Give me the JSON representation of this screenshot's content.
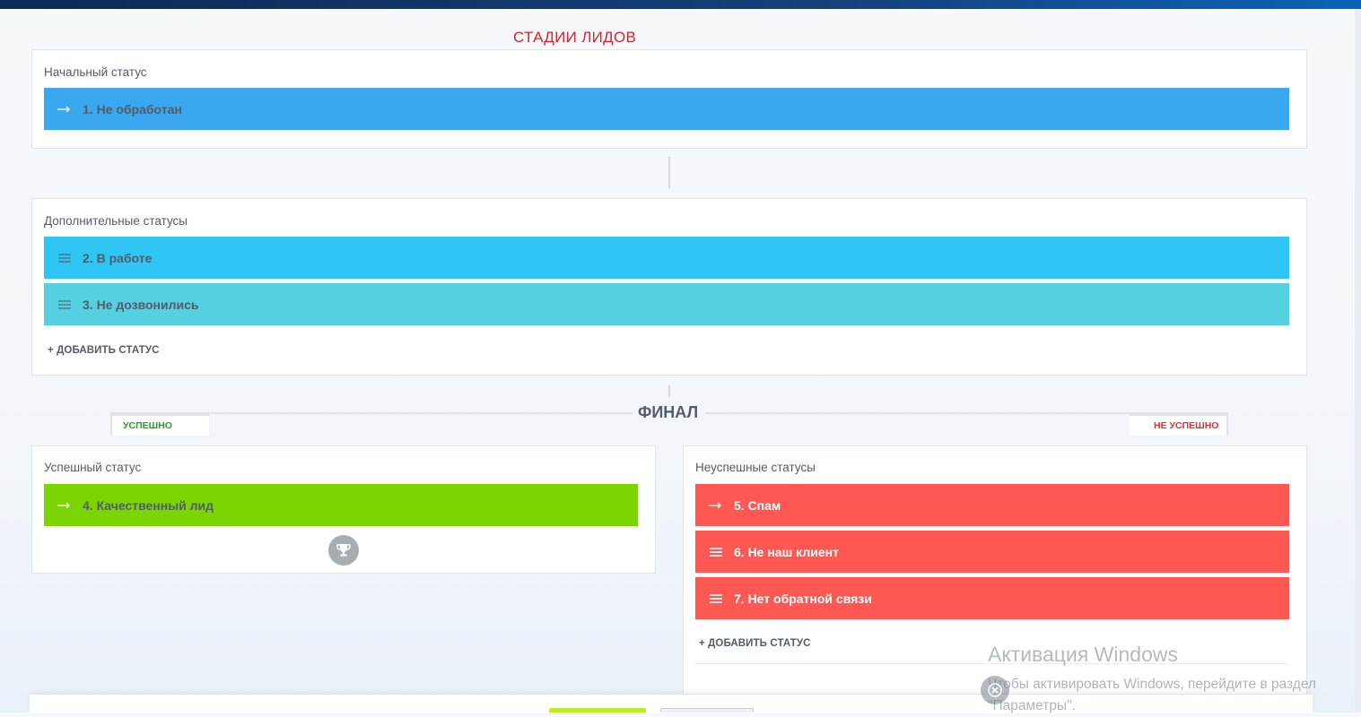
{
  "page": {
    "title": "СТАДИИ ЛИДОВ"
  },
  "initial": {
    "title": "Начальный статус",
    "stages": [
      {
        "label": "1. Не обработан",
        "icon": "arrow-right-icon",
        "color": "#39a8ef"
      }
    ]
  },
  "additional": {
    "title": "Дополнительные статусы",
    "stages": [
      {
        "label": "2. В работе",
        "icon": "drag-handle-icon",
        "color": "#2fc6f6"
      },
      {
        "label": "3. Не дозвонились",
        "icon": "drag-handle-icon",
        "color": "#55d0e0"
      }
    ],
    "add_label": "+ ДОБАВИТЬ СТАТУС"
  },
  "final": {
    "title": "ФИНАЛ",
    "success_tab": "УСПЕШНО",
    "fail_tab": "НЕ УСПЕШНО",
    "success": {
      "title": "Успешный статус",
      "stages": [
        {
          "label": "4. Качественный лид",
          "icon": "arrow-right-icon",
          "color": "#7bd500"
        }
      ],
      "trophy_icon": "trophy-icon"
    },
    "fail": {
      "title": "Неуспешные статусы",
      "stages": [
        {
          "label": "5. Спам",
          "icon": "arrow-right-icon",
          "color": "#ff5752"
        },
        {
          "label": "6. Не наш клиент",
          "icon": "drag-handle-icon",
          "color": "#ff5752"
        },
        {
          "label": "7. Нет обратной связи",
          "icon": "drag-handle-icon",
          "color": "#ff5752"
        }
      ],
      "add_label": "+ ДОБАВИТЬ СТАТУС"
    }
  },
  "windows_activation": {
    "title": "Активация Windows",
    "subtitle_line1": "Чтобы активировать Windows, перейдите в раздел",
    "subtitle_line2": "\"Параметры\"."
  }
}
